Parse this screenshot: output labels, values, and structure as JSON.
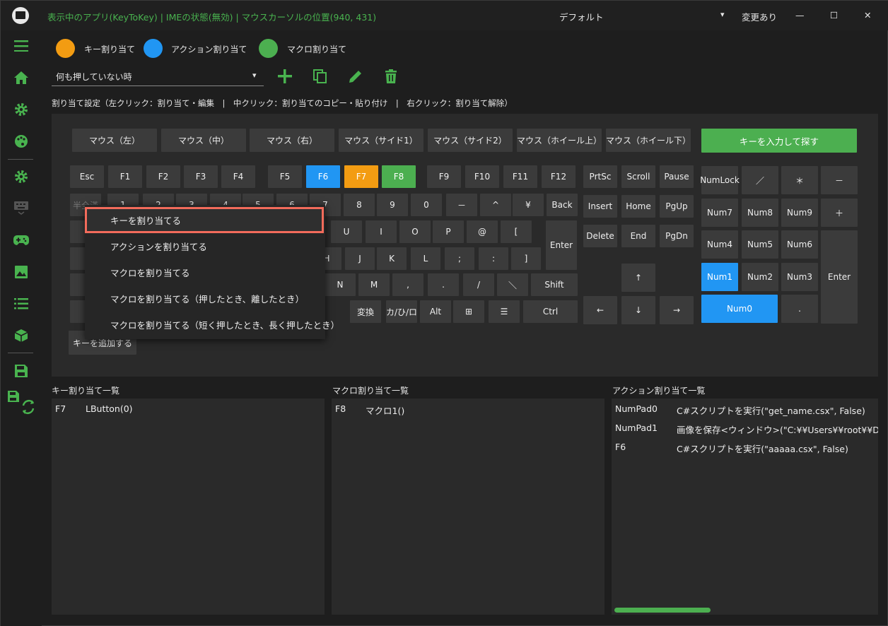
{
  "titlebar": {
    "app_info": "表示中のアプリ(KeyToKey) | IMEの状態(無効) | マウスカーソルの位置(940, 431)",
    "profile": "デフォルト",
    "profile_arrow": "▾",
    "changed": "変更あり",
    "min": "—",
    "max": "☐",
    "close": "✕"
  },
  "legend": {
    "key": "キー割り当て",
    "action": "アクション割り当て",
    "macro": "マクロ割り当て",
    "key_color": "#f39c12",
    "action_color": "#2196f3",
    "macro_color": "#4caf50"
  },
  "condition": {
    "value": "何も押していない時",
    "arrow": "▾"
  },
  "help_text": "割り当て設定（左クリック：割り当て・編集　|　中クリック：割り当てのコピー・貼り付け　|　右クリック：割り当て解除）",
  "mouse_buttons": [
    "マウス（左）",
    "マウス（中）",
    "マウス（右）",
    "マウス（サイド1）",
    "マウス（サイド2）",
    "マウス（ホイール上）",
    "マウス（ホイール下）"
  ],
  "search_key_button": "キーを入力して探す",
  "fn_row": [
    "Esc",
    "F1",
    "F2",
    "F3",
    "F4",
    "F5",
    "F6",
    "F7",
    "F8",
    "F9",
    "F10",
    "F11",
    "F12"
  ],
  "nav_row1": [
    "PrtSc",
    "Scroll",
    "Pause"
  ],
  "nav_row2": [
    "Insert",
    "Home",
    "PgUp"
  ],
  "nav_row3": [
    "Delete",
    "End",
    "PgDn"
  ],
  "num_row": [
    "半全漢",
    "1",
    "2",
    "3",
    "4",
    "5",
    "6",
    "7",
    "8",
    "9",
    "0",
    "－",
    "^",
    "¥",
    "Back"
  ],
  "q_row_visible": [
    "U",
    "I",
    "O",
    "P",
    "@",
    "["
  ],
  "a_row_visible": [
    "H",
    "J",
    "K",
    "L",
    ";",
    ":",
    "]"
  ],
  "z_row_visible": [
    "N",
    "M",
    ",",
    ".",
    "/",
    "＼",
    "Shift"
  ],
  "bottom_row_visible": [
    "変換",
    "カ/ひ/ロ",
    "Alt",
    "⊞",
    "☰",
    "Ctrl"
  ],
  "enter_key": "Enter",
  "arrows": [
    "↑",
    "←",
    "↓",
    "→"
  ],
  "numpad": {
    "r1": [
      "NumLock",
      "／",
      "＊",
      "－"
    ],
    "r2": [
      "Num7",
      "Num8",
      "Num9",
      "＋"
    ],
    "r3": [
      "Num4",
      "Num5",
      "Num6"
    ],
    "r4": [
      "Num1",
      "Num2",
      "Num3"
    ],
    "enter": "Enter",
    "num0": "Num0",
    "dot": "."
  },
  "add_key_button": "キーを追加する",
  "context_menu": [
    "キーを割り当てる",
    "アクションを割り当てる",
    "マクロを割り当てる",
    "マクロを割り当てる（押したとき、離したとき）",
    "マクロを割り当てる（短く押したとき、長く押したとき）"
  ],
  "lists": {
    "key": {
      "title": "キー割り当て一覧",
      "rows": [
        {
          "k": "F7",
          "v": "LButton(0)"
        }
      ]
    },
    "macro": {
      "title": "マクロ割り当て一覧",
      "rows": [
        {
          "k": "F8",
          "v": "マクロ1()"
        }
      ]
    },
    "action": {
      "title": "アクション割り当て一覧",
      "rows": [
        {
          "k": "NumPad0",
          "v": "C#スクリプトを実行(\"get_name.csx\", False)"
        },
        {
          "k": "NumPad1",
          "v": "画像を保存<ウィンドウ>(\"C:¥¥Users¥¥root¥¥Deskt"
        },
        {
          "k": "F6",
          "v": "C#スクリプトを実行(\"aaaaa.csx\", False)"
        }
      ]
    }
  },
  "colors": {
    "accent_green": "#49b34f",
    "active_blue": "#2196f3",
    "active_orange": "#f39c12",
    "active_green": "#4caf50",
    "highlight_border": "#f26b5b"
  }
}
